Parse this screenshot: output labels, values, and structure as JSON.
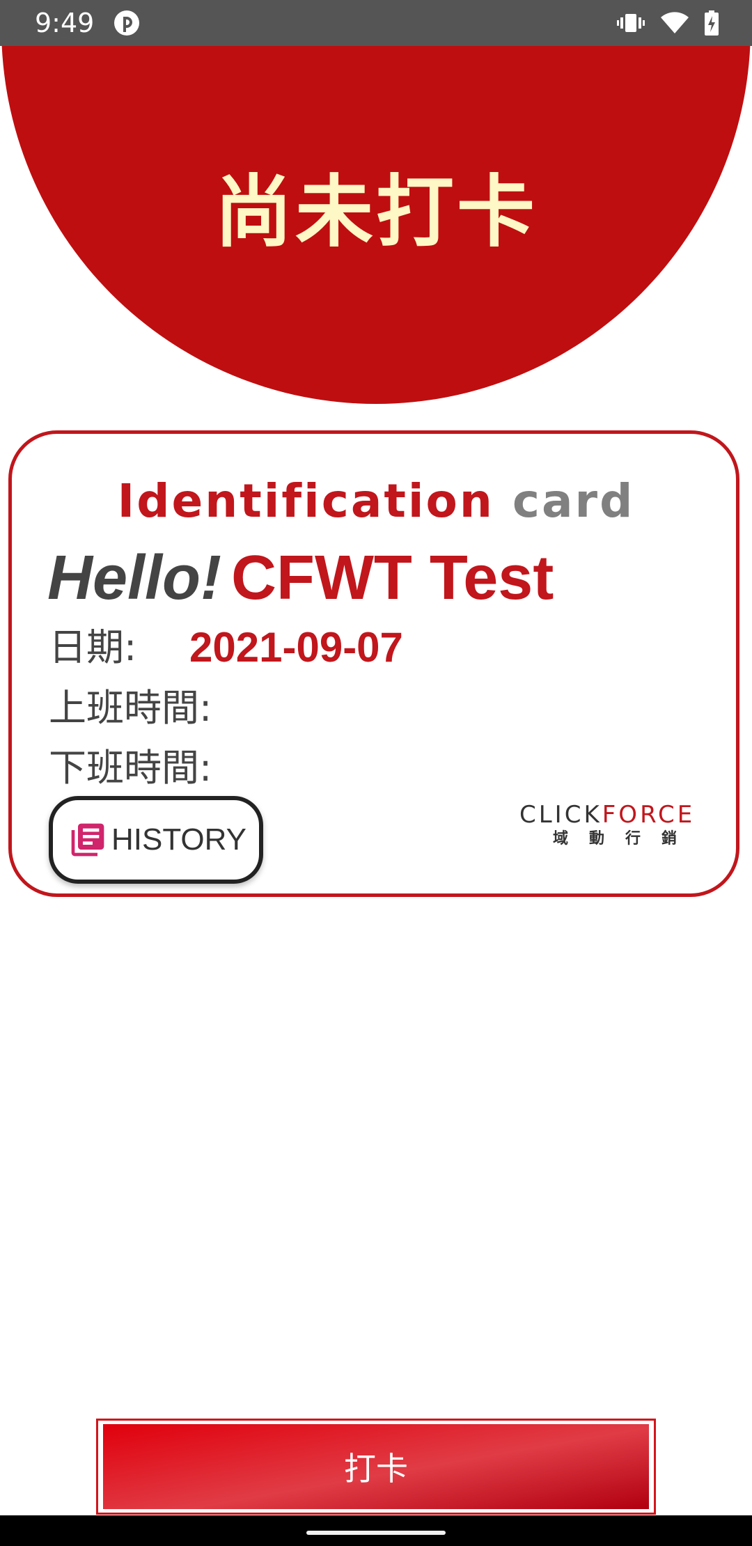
{
  "status_bar": {
    "time": "9:49",
    "icons": [
      "app-notification-icon",
      "vibrate-icon",
      "wifi-icon",
      "battery-charging-icon"
    ]
  },
  "header": {
    "title": "尚未打卡",
    "color": "#bf0e10",
    "title_color": "#fef7c6"
  },
  "card": {
    "title_part1": "Identification",
    "title_part2": "card",
    "greeting": "Hello!",
    "user_name": "CFWT Test",
    "date_label": "日期:",
    "date_value": "2021-09-07",
    "clock_in_label": "上班時間:",
    "clock_in_value": "",
    "clock_out_label": "下班時間:",
    "clock_out_value": "",
    "history_button_label": "HISTORY",
    "history_icon": "library-books-icon",
    "accent_color": "#c1161c"
  },
  "logo": {
    "text_part1": "CLICK",
    "text_part2": "FORCE",
    "subtitle": "域動行銷"
  },
  "punch_button": {
    "label": "打卡"
  }
}
